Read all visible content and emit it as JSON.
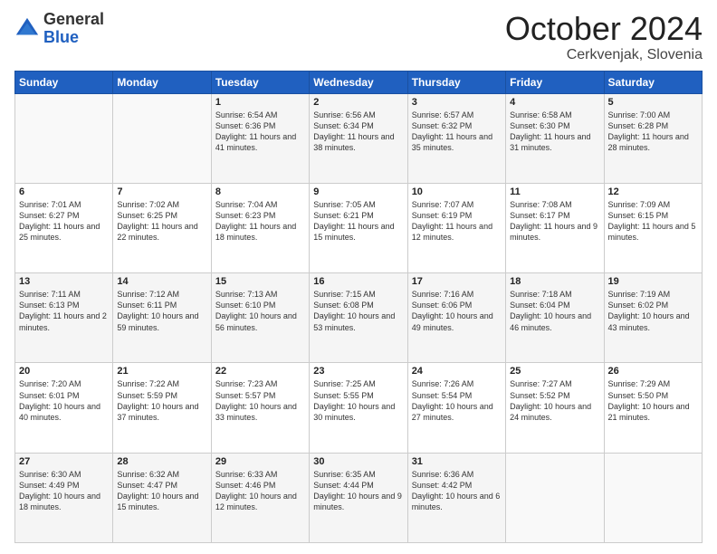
{
  "header": {
    "logo_general": "General",
    "logo_blue": "Blue",
    "month": "October 2024",
    "location": "Cerkvenjak, Slovenia"
  },
  "days_of_week": [
    "Sunday",
    "Monday",
    "Tuesday",
    "Wednesday",
    "Thursday",
    "Friday",
    "Saturday"
  ],
  "weeks": [
    [
      {
        "day": "",
        "content": ""
      },
      {
        "day": "",
        "content": ""
      },
      {
        "day": "1",
        "content": "Sunrise: 6:54 AM\nSunset: 6:36 PM\nDaylight: 11 hours and 41 minutes."
      },
      {
        "day": "2",
        "content": "Sunrise: 6:56 AM\nSunset: 6:34 PM\nDaylight: 11 hours and 38 minutes."
      },
      {
        "day": "3",
        "content": "Sunrise: 6:57 AM\nSunset: 6:32 PM\nDaylight: 11 hours and 35 minutes."
      },
      {
        "day": "4",
        "content": "Sunrise: 6:58 AM\nSunset: 6:30 PM\nDaylight: 11 hours and 31 minutes."
      },
      {
        "day": "5",
        "content": "Sunrise: 7:00 AM\nSunset: 6:28 PM\nDaylight: 11 hours and 28 minutes."
      }
    ],
    [
      {
        "day": "6",
        "content": "Sunrise: 7:01 AM\nSunset: 6:27 PM\nDaylight: 11 hours and 25 minutes."
      },
      {
        "day": "7",
        "content": "Sunrise: 7:02 AM\nSunset: 6:25 PM\nDaylight: 11 hours and 22 minutes."
      },
      {
        "day": "8",
        "content": "Sunrise: 7:04 AM\nSunset: 6:23 PM\nDaylight: 11 hours and 18 minutes."
      },
      {
        "day": "9",
        "content": "Sunrise: 7:05 AM\nSunset: 6:21 PM\nDaylight: 11 hours and 15 minutes."
      },
      {
        "day": "10",
        "content": "Sunrise: 7:07 AM\nSunset: 6:19 PM\nDaylight: 11 hours and 12 minutes."
      },
      {
        "day": "11",
        "content": "Sunrise: 7:08 AM\nSunset: 6:17 PM\nDaylight: 11 hours and 9 minutes."
      },
      {
        "day": "12",
        "content": "Sunrise: 7:09 AM\nSunset: 6:15 PM\nDaylight: 11 hours and 5 minutes."
      }
    ],
    [
      {
        "day": "13",
        "content": "Sunrise: 7:11 AM\nSunset: 6:13 PM\nDaylight: 11 hours and 2 minutes."
      },
      {
        "day": "14",
        "content": "Sunrise: 7:12 AM\nSunset: 6:11 PM\nDaylight: 10 hours and 59 minutes."
      },
      {
        "day": "15",
        "content": "Sunrise: 7:13 AM\nSunset: 6:10 PM\nDaylight: 10 hours and 56 minutes."
      },
      {
        "day": "16",
        "content": "Sunrise: 7:15 AM\nSunset: 6:08 PM\nDaylight: 10 hours and 53 minutes."
      },
      {
        "day": "17",
        "content": "Sunrise: 7:16 AM\nSunset: 6:06 PM\nDaylight: 10 hours and 49 minutes."
      },
      {
        "day": "18",
        "content": "Sunrise: 7:18 AM\nSunset: 6:04 PM\nDaylight: 10 hours and 46 minutes."
      },
      {
        "day": "19",
        "content": "Sunrise: 7:19 AM\nSunset: 6:02 PM\nDaylight: 10 hours and 43 minutes."
      }
    ],
    [
      {
        "day": "20",
        "content": "Sunrise: 7:20 AM\nSunset: 6:01 PM\nDaylight: 10 hours and 40 minutes."
      },
      {
        "day": "21",
        "content": "Sunrise: 7:22 AM\nSunset: 5:59 PM\nDaylight: 10 hours and 37 minutes."
      },
      {
        "day": "22",
        "content": "Sunrise: 7:23 AM\nSunset: 5:57 PM\nDaylight: 10 hours and 33 minutes."
      },
      {
        "day": "23",
        "content": "Sunrise: 7:25 AM\nSunset: 5:55 PM\nDaylight: 10 hours and 30 minutes."
      },
      {
        "day": "24",
        "content": "Sunrise: 7:26 AM\nSunset: 5:54 PM\nDaylight: 10 hours and 27 minutes."
      },
      {
        "day": "25",
        "content": "Sunrise: 7:27 AM\nSunset: 5:52 PM\nDaylight: 10 hours and 24 minutes."
      },
      {
        "day": "26",
        "content": "Sunrise: 7:29 AM\nSunset: 5:50 PM\nDaylight: 10 hours and 21 minutes."
      }
    ],
    [
      {
        "day": "27",
        "content": "Sunrise: 6:30 AM\nSunset: 4:49 PM\nDaylight: 10 hours and 18 minutes."
      },
      {
        "day": "28",
        "content": "Sunrise: 6:32 AM\nSunset: 4:47 PM\nDaylight: 10 hours and 15 minutes."
      },
      {
        "day": "29",
        "content": "Sunrise: 6:33 AM\nSunset: 4:46 PM\nDaylight: 10 hours and 12 minutes."
      },
      {
        "day": "30",
        "content": "Sunrise: 6:35 AM\nSunset: 4:44 PM\nDaylight: 10 hours and 9 minutes."
      },
      {
        "day": "31",
        "content": "Sunrise: 6:36 AM\nSunset: 4:42 PM\nDaylight: 10 hours and 6 minutes."
      },
      {
        "day": "",
        "content": ""
      },
      {
        "day": "",
        "content": ""
      }
    ]
  ]
}
